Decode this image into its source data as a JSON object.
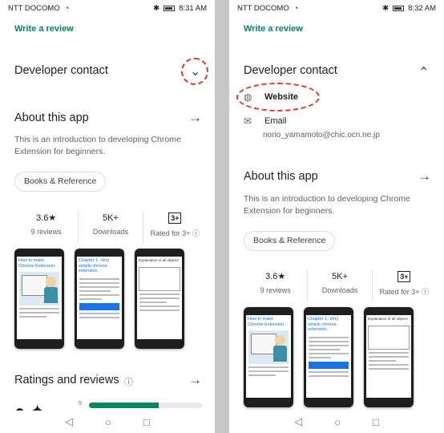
{
  "left": {
    "status": {
      "carrier": "NTT DOCOMO",
      "time": "8:31 AM"
    },
    "write_review": "Write a review",
    "developer_contact": "Developer contact",
    "about_title": "About this app",
    "about_desc": "This is an introduction to developing Chrome Extension for beginners.",
    "category": "Books & Reference",
    "stats": {
      "rating": "3.6★",
      "reviews": "9 reviews",
      "downloads": "5K+",
      "downloads_label": "Downloads",
      "rated_badge": "3+",
      "rated_label": "Rated for 3+ ⓘ"
    },
    "ratings_title": "Ratings and reviews",
    "ratings_info": "ⓘ",
    "ratings_bar_5": "5",
    "ratings_bar_5_fill": 0.62,
    "screenshot_titles": [
      "How to make Chrome Extension.",
      "Chapter 1. Very simple chrome extension.",
      "Explanation of all objects"
    ]
  },
  "right": {
    "status": {
      "carrier": "NTT DOCOMO",
      "time": "8:32 AM"
    },
    "write_review": "Write a review",
    "developer_contact": "Developer contact",
    "website": "Website",
    "email_label": "Email",
    "email_value": "norio_yamamoto@chic.ocn.ne.jp",
    "about_title": "About this app",
    "about_desc": "This is an introduction to developing Chrome Extension for beginners.",
    "category": "Books & Reference",
    "stats": {
      "rating": "3.6★",
      "reviews": "9 reviews",
      "downloads": "5K+",
      "downloads_label": "Downloads",
      "rated_badge": "3+",
      "rated_label": "Rated for 3+ ⓘ"
    },
    "screenshot_titles": [
      "How to make Chrome Extension.",
      "Chapter 1. Very simple chrome extension.",
      "Explanation of all objects"
    ]
  },
  "icons": {
    "chevron_down": "chevron-down-icon",
    "chevron_up": "chevron-up-icon",
    "arrow": "arrow-right-icon",
    "globe": "globe-icon",
    "mail": "mail-icon"
  },
  "colors": {
    "accent_green": "#01875f",
    "highlight_red": "#e5312b"
  }
}
